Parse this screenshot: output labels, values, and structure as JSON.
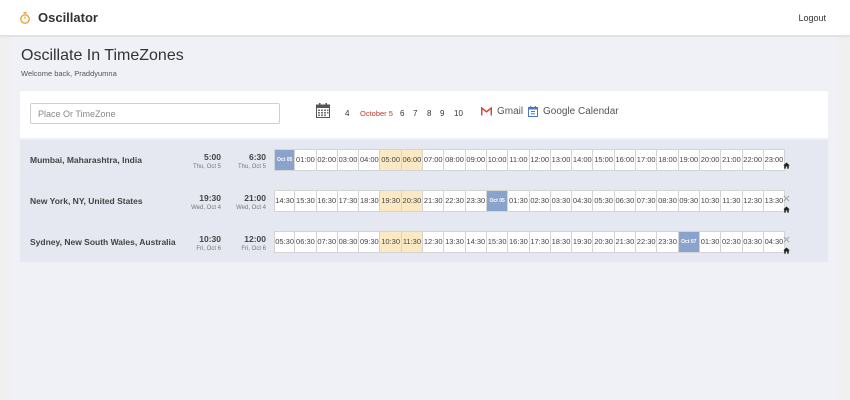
{
  "app": {
    "name": "Oscillator",
    "logout_label": "Logout"
  },
  "page": {
    "title": "Oscillate In TimeZones",
    "welcome": "Welcome back, Praddyumna"
  },
  "search": {
    "placeholder": "Place Or TimeZone",
    "value": ""
  },
  "date_picker": {
    "days": [
      "4",
      "October 5",
      "6",
      "7",
      "8",
      "9",
      "10"
    ],
    "selected": "October 5"
  },
  "links": {
    "gmail_label": "Gmail",
    "gcal_label": "Google Calendar"
  },
  "colors": {
    "selected_day": "#c0392b",
    "highlight": "#8aa3cc",
    "working_hours": "#fbe9c4"
  },
  "zones": [
    {
      "name": "Mumbai, Maharashtra, India",
      "current_time": "5:00",
      "current_date": "Thu, Oct 5",
      "selected_time": "6:30",
      "selected_date": "Thu, Oct 5",
      "hours": [
        "Oct 05",
        "01:00",
        "02:00",
        "03:00",
        "04:00",
        "05:00",
        "06:00",
        "07:00",
        "08:00",
        "09:00",
        "10:00",
        "11:00",
        "12:00",
        "13:00",
        "14:00",
        "15:00",
        "16:00",
        "17:00",
        "18:00",
        "19:00",
        "20:00",
        "21:00",
        "22:00",
        "23:00"
      ],
      "highlight_index": 0,
      "work_hours": [
        5,
        6
      ],
      "actions": [
        "home-icon"
      ]
    },
    {
      "name": "New York, NY, United States",
      "current_time": "19:30",
      "current_date": "Wed, Oct 4",
      "selected_time": "21:00",
      "selected_date": "Wed, Oct 4",
      "hours": [
        "14:30",
        "15:30",
        "16:30",
        "17:30",
        "18:30",
        "19:30",
        "20:30",
        "21:30",
        "22:30",
        "23:30",
        "Oct 05",
        "01:30",
        "02:30",
        "03:30",
        "04:30",
        "05:30",
        "06:30",
        "07:30",
        "08:30",
        "09:30",
        "10:30",
        "11:30",
        "12:30",
        "13:30"
      ],
      "highlight_index": 10,
      "work_hours": [
        5,
        6
      ],
      "actions": [
        "close-icon",
        "home-icon"
      ]
    },
    {
      "name": "Sydney, New South Wales, Australia",
      "current_time": "10:30",
      "current_date": "Fri, Oct 6",
      "selected_time": "12:00",
      "selected_date": "Fri, Oct 6",
      "hours": [
        "05:30",
        "06:30",
        "07:30",
        "08:30",
        "09:30",
        "10:30",
        "11:30",
        "12:30",
        "13:30",
        "14:30",
        "15:30",
        "16:30",
        "17:30",
        "18:30",
        "19:30",
        "20:30",
        "21:30",
        "22:30",
        "23:30",
        "Oct 07",
        "01:30",
        "02:30",
        "03:30",
        "04:30"
      ],
      "highlight_index": 19,
      "work_hours": [
        5,
        6
      ],
      "actions": [
        "close-icon",
        "home-icon"
      ]
    }
  ]
}
